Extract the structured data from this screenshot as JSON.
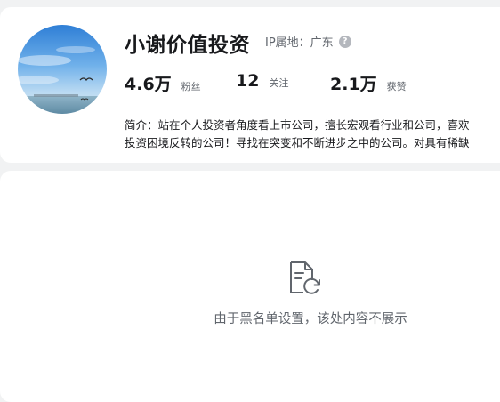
{
  "profile": {
    "name": "小谢价值投资",
    "ip_location": "IP属地：广东",
    "help_icon": "question-circle-icon",
    "stats": [
      {
        "value": "4.6万",
        "label": "粉丝"
      },
      {
        "value": "12",
        "label": "关注"
      },
      {
        "value": "2.1万",
        "label": "获赞"
      }
    ],
    "bio_line1": "简介：站在个人投资者角度看上市公司，擅长宏观看行业和公司，喜欢",
    "bio_line2": "投资困境反转的公司！寻找在突变和不断进步之中的公司。对具有稀缺"
  },
  "content": {
    "empty_icon": "document-refresh-icon",
    "empty_message": "由于黑名单设置，该处内容不展示"
  },
  "colors": {
    "background": "#f1f2f3",
    "card": "#ffffff",
    "text_primary": "#18191c",
    "text_secondary": "#61666d"
  }
}
